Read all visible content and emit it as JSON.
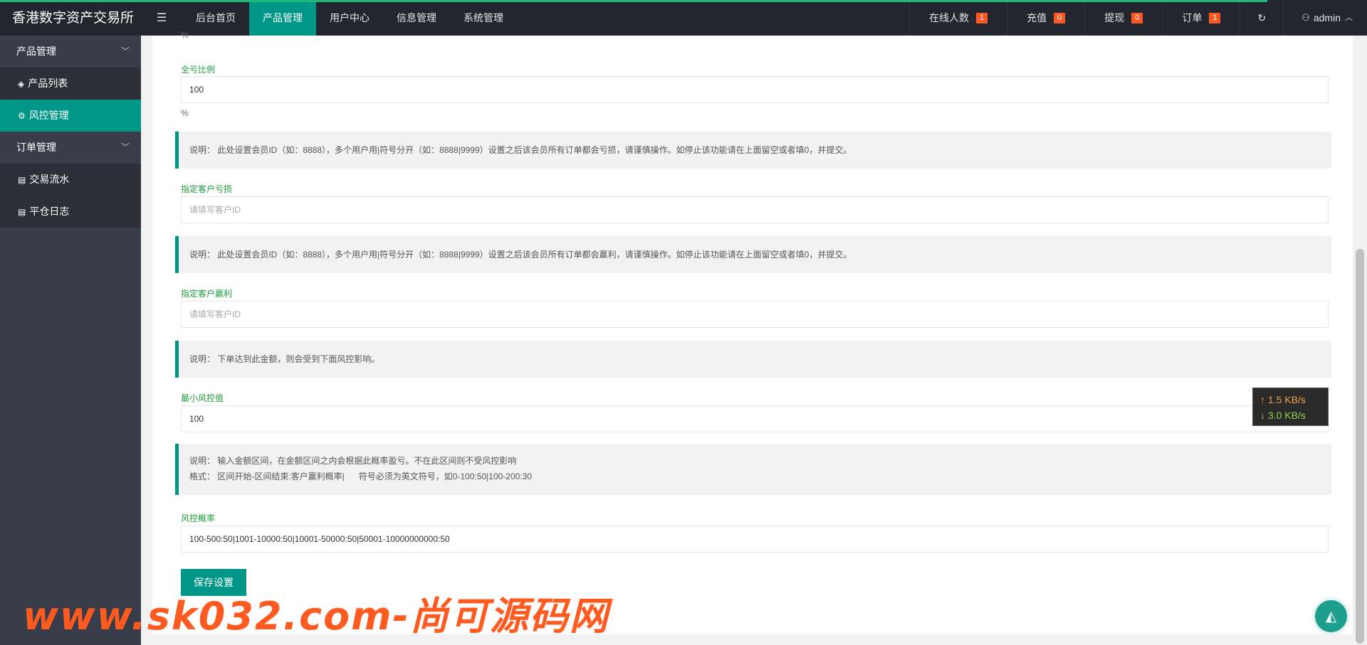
{
  "header": {
    "logo": "香港数字资产交易所",
    "menu_icon": "menu-icon",
    "nav": [
      "后台首页",
      "产品管理",
      "用户中心",
      "信息管理",
      "系统管理"
    ],
    "active_nav": 1,
    "right": [
      {
        "label": "在线人数",
        "badge": "1"
      },
      {
        "label": "充值",
        "badge": "0"
      },
      {
        "label": "提现",
        "badge": "0"
      },
      {
        "label": "订单",
        "badge": "1"
      }
    ],
    "refresh_icon": "refresh-icon",
    "user": "admin"
  },
  "sidebar": {
    "groups": [
      {
        "label": "产品管理",
        "items": [
          {
            "label": "产品列表",
            "icon": "layers-icon"
          },
          {
            "label": "风控管理",
            "icon": "gear-icon",
            "active": true
          }
        ]
      },
      {
        "label": "订单管理",
        "items": [
          {
            "label": "交易流水",
            "icon": "file-icon"
          },
          {
            "label": "平仓日志",
            "icon": "file-icon"
          }
        ]
      }
    ]
  },
  "form": {
    "top_unit": "%",
    "full_loss_label": "全亏比例",
    "full_loss_value": "100",
    "full_loss_unit": "%",
    "note1": "说明： 此处设置会员ID（如：8888），多个用户用|符号分开（如：8888|9999）设置之后该会员所有订单都会亏损，请谨慎操作。如停止该功能请在上面留空或者填0，并提交。",
    "loss_user_label": "指定客户亏损",
    "loss_user_placeholder": "请填写客户ID",
    "note2": "说明： 此处设置会员ID（如：8888），多个用户用|符号分开（如：8888|9999）设置之后该会员所有订单都会赢利，请谨慎操作。如停止该功能请在上面留空或者填0，并提交。",
    "win_user_label": "指定客户赢利",
    "win_user_placeholder": "请填写客户ID",
    "note3": "说明： 下单达到此金额，则会受到下面风控影响。",
    "min_risk_label": "最小风控值",
    "min_risk_value": "100",
    "note4_line1": "说明： 输入金额区间，在金额区间之内会根据此概率盈亏。不在此区间则不受风控影响",
    "note4_line2": "格式： 区间开始-区间结束:客户赢利概率|      符号必须为英文符号，如0-100:50|100-200:30",
    "risk_prob_label": "风控概率",
    "risk_prob_value": "100-500:50|1001-10000:50|10001-50000:50|50001-10000000000:50",
    "save_button": "保存设置"
  },
  "speed": {
    "up": "1.5 KB/s",
    "down": "3.0 KB/s"
  },
  "watermark": "www.sk032.com-尚可源码网",
  "colors": {
    "header_bg": "#23262e",
    "sidebar_bg": "#393d49",
    "accent": "#009688",
    "badge": "#ff5722",
    "label_green": "#1e9e3c"
  }
}
